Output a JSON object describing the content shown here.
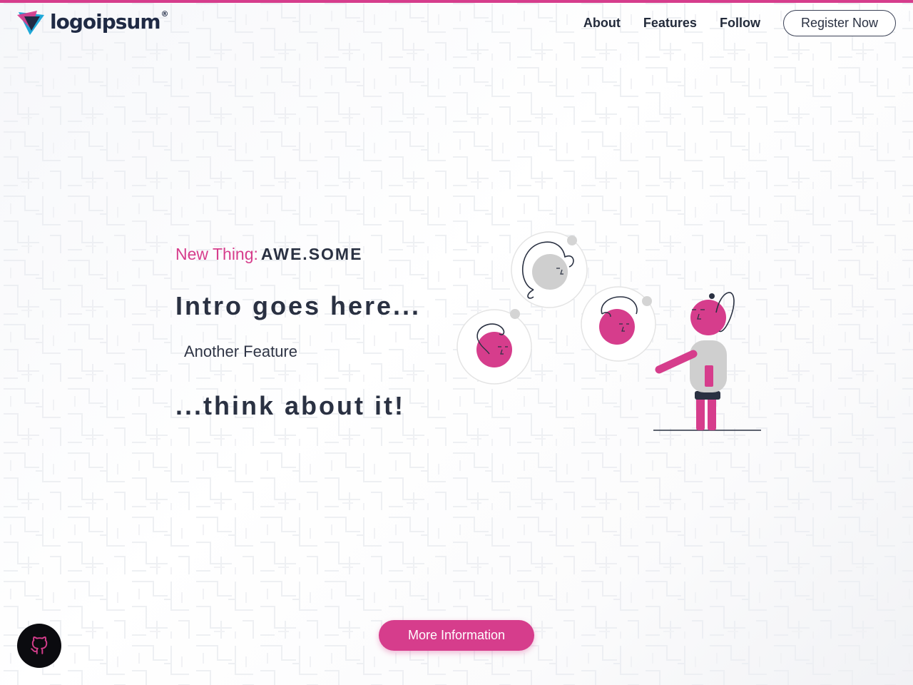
{
  "brand": {
    "name": "logoipsum",
    "trademark": "®",
    "accent_color": "#d63d8c",
    "text_color": "#2a3142"
  },
  "nav": {
    "items": [
      {
        "label": "About"
      },
      {
        "label": "Features"
      },
      {
        "label": "Follow"
      }
    ],
    "register_label": "Register Now"
  },
  "hero": {
    "eyebrow_prefix": "New Thing:",
    "eyebrow_highlight": "AWE.SOME",
    "intro": "Intro goes here...",
    "feature": "Another Feature",
    "outro": "...think about it!"
  },
  "cta": {
    "more_label": "More Information"
  },
  "icons": {
    "github": "github-icon",
    "logo": "logo-mark-icon"
  }
}
